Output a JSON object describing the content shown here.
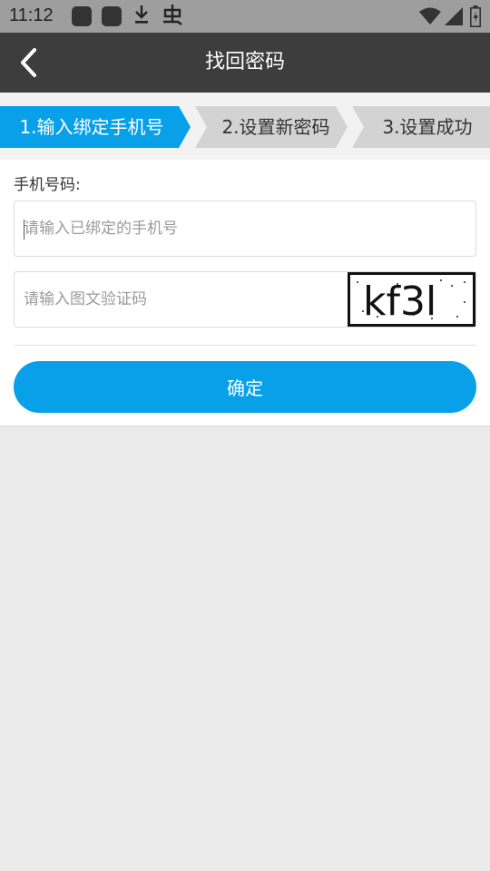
{
  "status_bar": {
    "time": "11:12",
    "icons": [
      "app-icon",
      "app-icon",
      "download-icon",
      "bug-icon",
      "wifi-icon",
      "signal-icon",
      "battery-icon"
    ]
  },
  "header": {
    "title": "找回密码",
    "back_icon": "chevron-left-icon"
  },
  "steps": [
    {
      "label": "1.输入绑定手机号",
      "active": true
    },
    {
      "label": "2.设置新密码",
      "active": false
    },
    {
      "label": "3.设置成功",
      "active": false
    }
  ],
  "form": {
    "phone_label": "手机号码:",
    "phone_placeholder": "请输入已绑定的手机号",
    "phone_value": "",
    "captcha_placeholder": "请输入图文验证码",
    "captcha_value": "",
    "captcha_image_text": "kf3l",
    "confirm_label": "确定"
  },
  "colors": {
    "accent": "#08a0e8",
    "title_bar": "#3d3d3d",
    "status_bar": "#9e9e9e",
    "step_inactive": "#d3d3d3",
    "page_background": "#ebebeb"
  }
}
